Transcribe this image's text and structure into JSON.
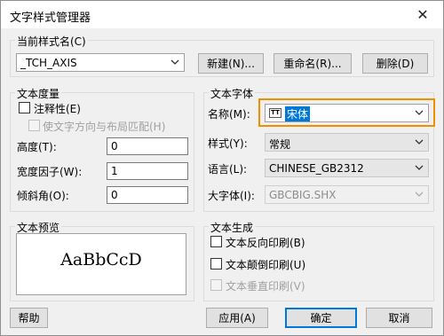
{
  "window": {
    "title": "文字样式管理器",
    "close_glyph": "✕"
  },
  "current_style": {
    "label": "当前样式名(C)",
    "value": "_TCH_AXIS"
  },
  "buttons": {
    "new": "新建(N)...",
    "rename": "重命名(R)...",
    "delete": "删除(D)",
    "help": "帮助",
    "apply": "应用(A)",
    "ok": "确定",
    "cancel": "取消"
  },
  "metrics": {
    "title": "文本度量",
    "annotative": "注释性(E)",
    "match_orientation": "使文字方向与布局匹配(H)",
    "height_label": "高度(T):",
    "height_value": "0",
    "width_factor_label": "宽度因子(W):",
    "width_factor_value": "1",
    "oblique_label": "倾斜角(O):",
    "oblique_value": "0"
  },
  "font": {
    "title": "文本字体",
    "name_label": "名称(M):",
    "name_value": "宋体",
    "name_icon": "truetype-font-icon",
    "style_label": "样式(Y):",
    "style_value": "常规",
    "language_label": "语言(L):",
    "language_value": "CHINESE_GB2312",
    "bigfont_label": "大字体(I):",
    "bigfont_value": "GBCBIG.SHX"
  },
  "preview": {
    "title": "文本预览",
    "sample": "AaBbCcD"
  },
  "generation": {
    "title": "文本生成",
    "backwards": "文本反向印刷(B)",
    "upside_down": "文本颠倒印刷(U)",
    "vertical": "文本垂直印刷(V)"
  },
  "colors": {
    "accent": "#0078d7",
    "highlight": "#f09000"
  }
}
